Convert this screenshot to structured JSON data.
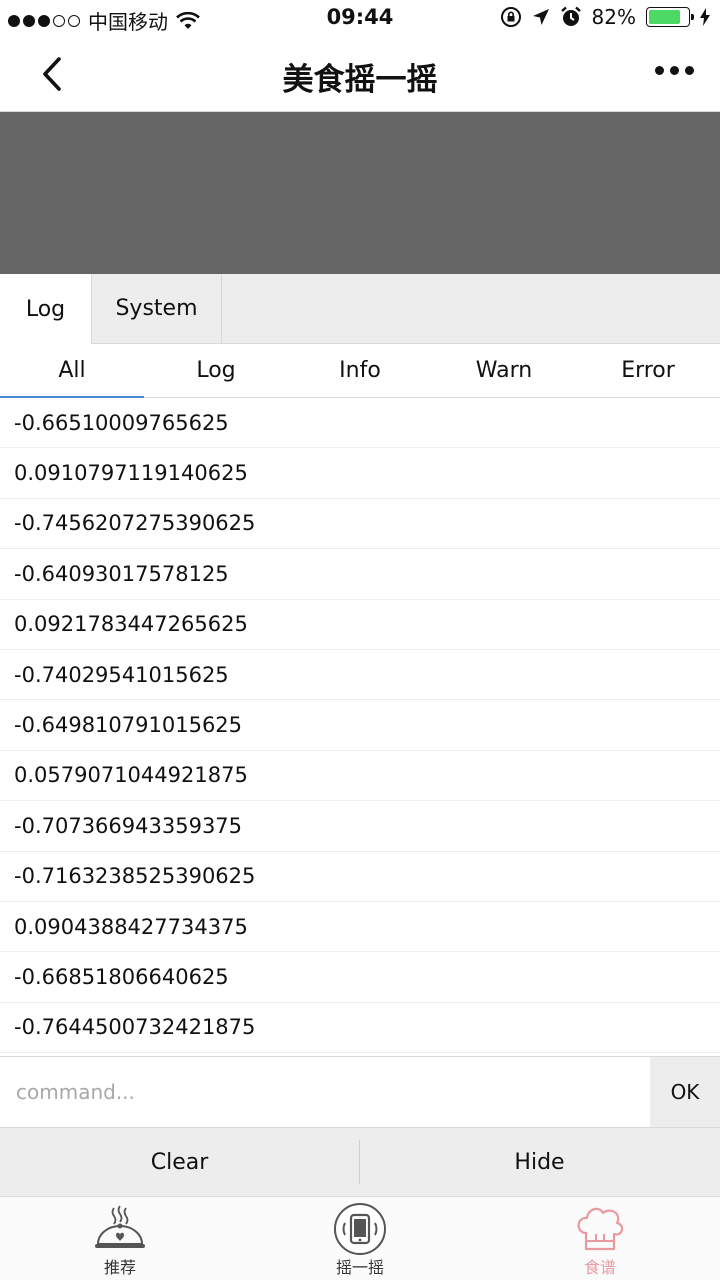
{
  "status_bar": {
    "carrier": "中国移动",
    "time": "09:44",
    "battery": "82%",
    "battery_level": 0.82
  },
  "nav": {
    "title": "美食摇一摇"
  },
  "console": {
    "top_tabs": [
      "Log",
      "System"
    ],
    "level_tabs": [
      "All",
      "Log",
      "Info",
      "Warn",
      "Error"
    ],
    "logs": [
      "-0.66510009765625",
      "0.0910797119140625",
      "-0.7456207275390625",
      "-0.64093017578125",
      "0.0921783447265625",
      "-0.74029541015625",
      "-0.649810791015625",
      "0.0579071044921875",
      "-0.707366943359375",
      "-0.7163238525390625",
      "0.0904388427734375",
      "-0.66851806640625",
      "-0.7644500732421875"
    ],
    "command_placeholder": "command...",
    "ok_label": "OK",
    "clear_label": "Clear",
    "hide_label": "Hide"
  },
  "tab_bar": {
    "items": [
      {
        "label": "推荐",
        "icon": "dish-icon"
      },
      {
        "label": "摇一摇",
        "icon": "shake-phone-icon"
      },
      {
        "label": "食谱",
        "icon": "chef-hat-icon"
      }
    ],
    "active_index": 2,
    "active_color": "#e89aa0"
  },
  "colors": {
    "banner": "#666666",
    "active_tab_underline": "#4a8ad8",
    "battery_fill": "#4cd964"
  }
}
